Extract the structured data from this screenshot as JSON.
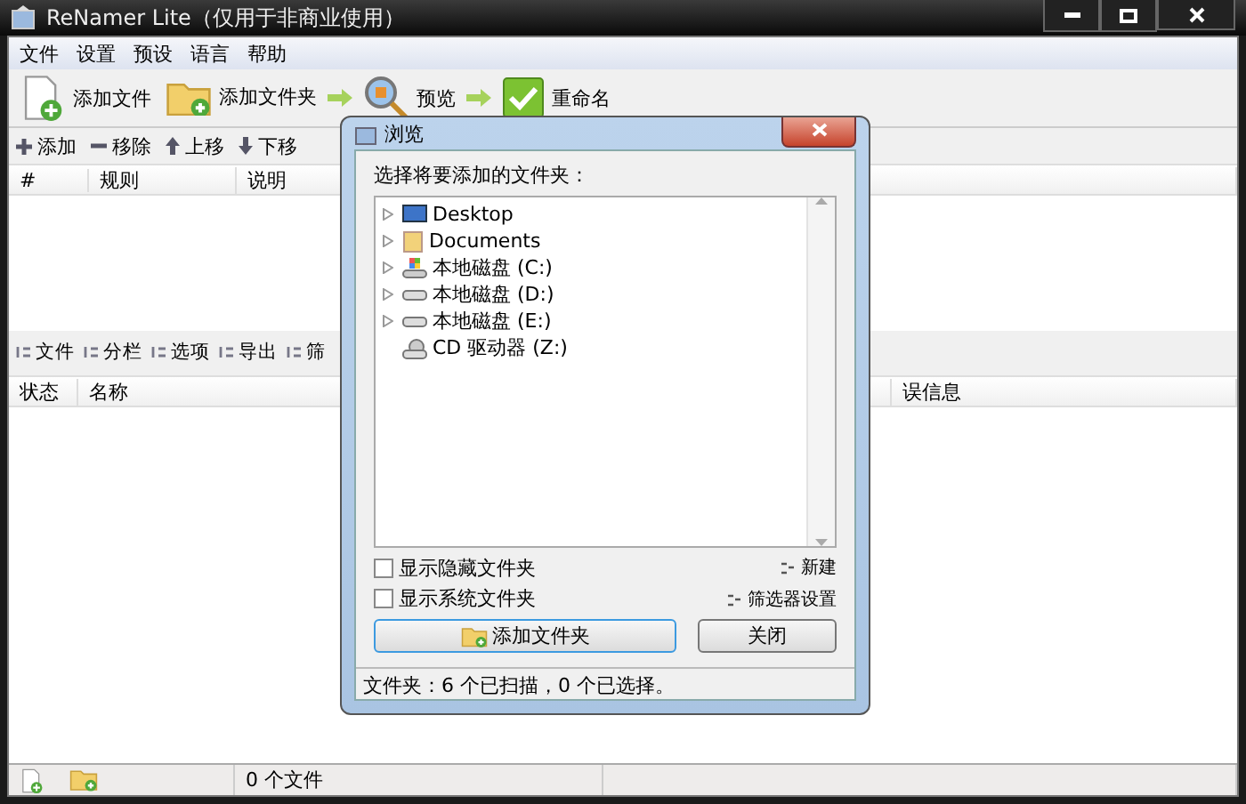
{
  "window": {
    "title": "ReNamer Lite（仅用于非商业使用）"
  },
  "menu": [
    "文件",
    "设置",
    "预设",
    "语言",
    "帮助"
  ],
  "toolbar": [
    {
      "label": "添加文件",
      "kind": "file"
    },
    {
      "label": "添加文件夹",
      "kind": "folder"
    },
    {
      "label": "预览",
      "kind": "preview"
    },
    {
      "label": "重命名",
      "kind": "rename"
    }
  ],
  "rules_toolbar": [
    {
      "label": "添加",
      "kind": "plus"
    },
    {
      "label": "移除",
      "kind": "minus"
    },
    {
      "label": "上移",
      "kind": "up"
    },
    {
      "label": "下移",
      "kind": "down"
    }
  ],
  "rules_columns": [
    "#",
    "规则",
    "说明"
  ],
  "files_toolbar": [
    "文件",
    "分栏",
    "选项",
    "导出",
    "筛"
  ],
  "files_columns": [
    "状态",
    "名称",
    "误信息"
  ],
  "status_bar": {
    "text": "0 个文件"
  },
  "dialog": {
    "title": "浏览",
    "prompt": "选择将要添加的文件夹：",
    "tree": [
      {
        "label": "Desktop",
        "kind": "desktop",
        "expanded": false
      },
      {
        "label": "Documents",
        "kind": "documents",
        "expanded": false
      },
      {
        "label": "本地磁盘 (C:)",
        "kind": "system",
        "expanded": false
      },
      {
        "label": "本地磁盘 (D:)",
        "kind": "drive",
        "expanded": false
      },
      {
        "label": "本地磁盘 (E:)",
        "kind": "drive",
        "expanded": false
      },
      {
        "label": "CD 驱动器 (Z:)",
        "kind": "cd"
      }
    ],
    "options": [
      {
        "label": "显示隐藏文件夹",
        "checked": false
      },
      {
        "label": "显示系统文件夹",
        "checked": false
      }
    ],
    "links": [
      "新建",
      "筛选器设置"
    ],
    "add_button": "添加文件夹",
    "close_button": "关闭",
    "status": "文件夹：6 个已扫描，0 个已选择。"
  }
}
